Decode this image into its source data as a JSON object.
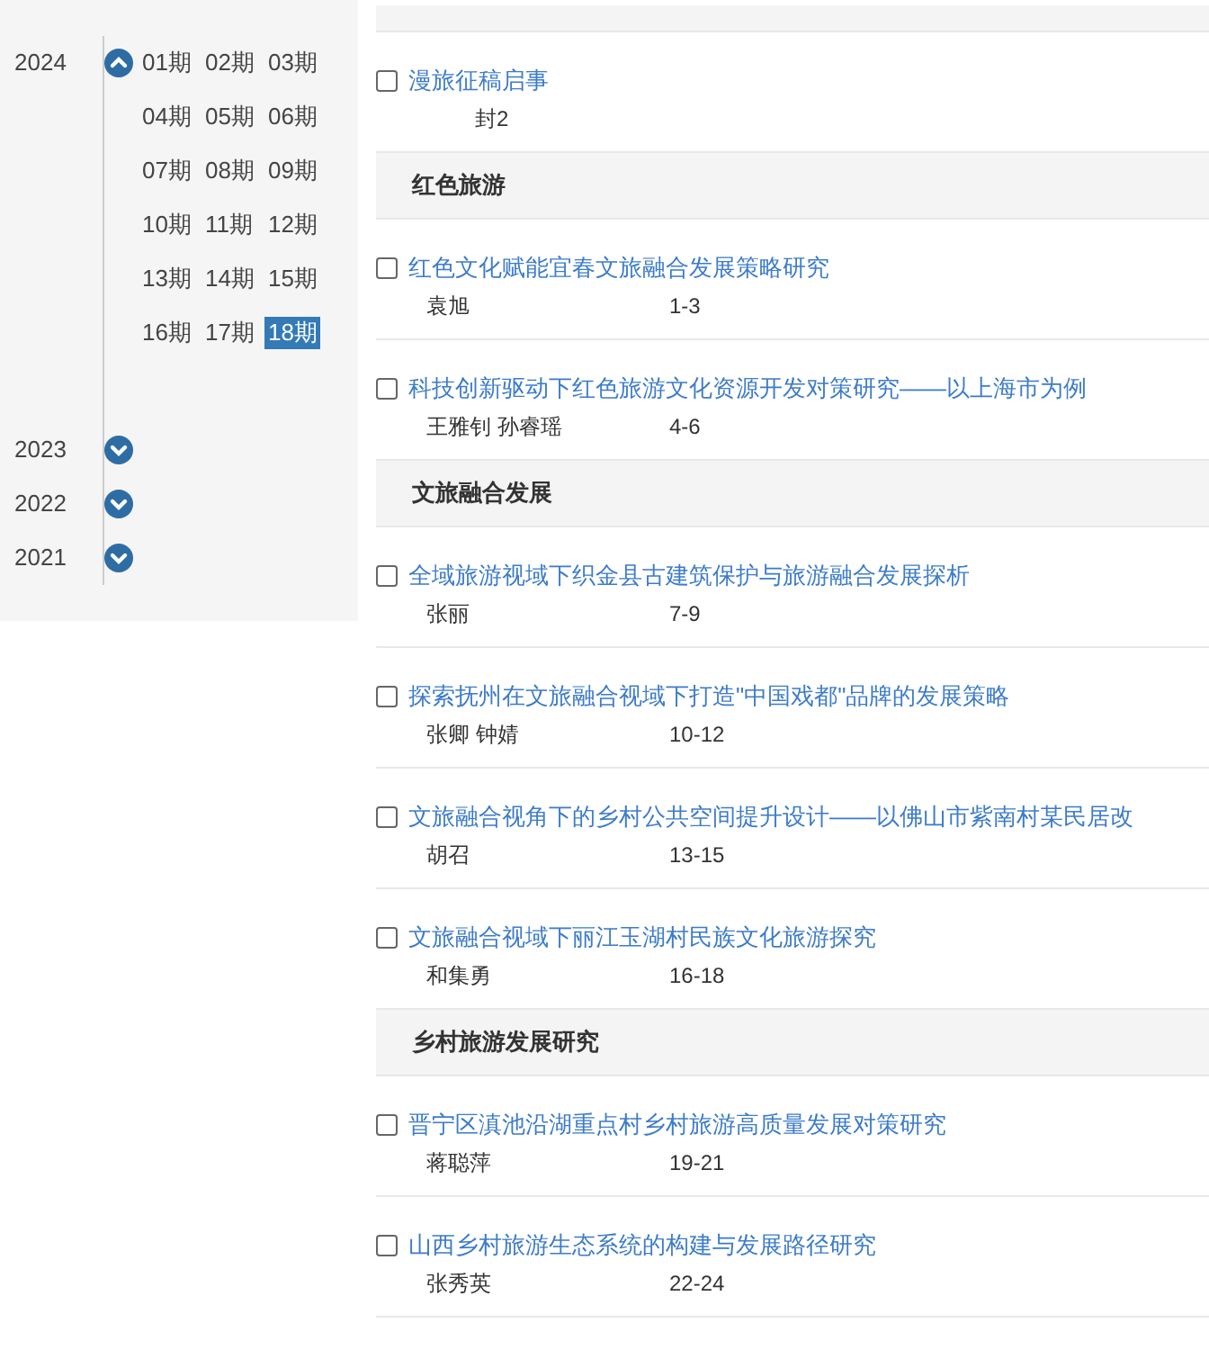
{
  "sidebar": {
    "years": [
      {
        "year": "2024",
        "expanded": true,
        "issues": [
          {
            "label": "01期",
            "selected": false
          },
          {
            "label": "02期",
            "selected": false
          },
          {
            "label": "03期",
            "selected": false
          },
          {
            "label": "04期",
            "selected": false
          },
          {
            "label": "05期",
            "selected": false
          },
          {
            "label": "06期",
            "selected": false
          },
          {
            "label": "07期",
            "selected": false
          },
          {
            "label": "08期",
            "selected": false
          },
          {
            "label": "09期",
            "selected": false
          },
          {
            "label": "10期",
            "selected": false
          },
          {
            "label": "11期",
            "selected": false
          },
          {
            "label": "12期",
            "selected": false
          },
          {
            "label": "13期",
            "selected": false
          },
          {
            "label": "14期",
            "selected": false
          },
          {
            "label": "15期",
            "selected": false
          },
          {
            "label": "16期",
            "selected": false
          },
          {
            "label": "17期",
            "selected": false
          },
          {
            "label": "18期",
            "selected": true
          }
        ]
      },
      {
        "year": "2023",
        "expanded": false
      },
      {
        "year": "2022",
        "expanded": false
      },
      {
        "year": "2021",
        "expanded": false
      }
    ]
  },
  "contents": [
    {
      "kind": "section"
    },
    {
      "kind": "article",
      "title": "漫旅征稿启事",
      "pages": "封2",
      "checked": false
    },
    {
      "kind": "section",
      "title": "红色旅游"
    },
    {
      "kind": "article",
      "title": "红色文化赋能宜春文旅融合发展策略研究",
      "authors": "袁旭",
      "pages": "1-3",
      "checked": false
    },
    {
      "kind": "article",
      "title": "科技创新驱动下红色旅游文化资源开发对策研究——以上海市为例",
      "authors": "王雅钊 孙睿瑶",
      "pages": "4-6",
      "checked": false
    },
    {
      "kind": "section",
      "title": "文旅融合发展"
    },
    {
      "kind": "article",
      "title": "全域旅游视域下织金县古建筑保护与旅游融合发展探析",
      "authors": "张丽",
      "pages": "7-9",
      "checked": false
    },
    {
      "kind": "article",
      "title": "探索抚州在文旅融合视域下打造\"中国戏都\"品牌的发展策略",
      "authors": "张卿 钟婧",
      "pages": "10-12",
      "checked": false
    },
    {
      "kind": "article",
      "title": "文旅融合视角下的乡村公共空间提升设计——以佛山市紫南村某民居改",
      "authors": "胡召",
      "pages": "13-15",
      "checked": false
    },
    {
      "kind": "article",
      "title": "文旅融合视域下丽江玉湖村民族文化旅游探究",
      "authors": "和集勇",
      "pages": "16-18",
      "checked": false
    },
    {
      "kind": "section",
      "title": "乡村旅游发展研究"
    },
    {
      "kind": "article",
      "title": "晋宁区滇池沿湖重点村乡村旅游高质量发展对策研究",
      "authors": "蒋聪萍",
      "pages": "19-21",
      "checked": false
    },
    {
      "kind": "article",
      "title": "山西乡村旅游生态系统的构建与发展路径研究",
      "authors": "张秀英",
      "pages": "22-24",
      "checked": false
    }
  ]
}
